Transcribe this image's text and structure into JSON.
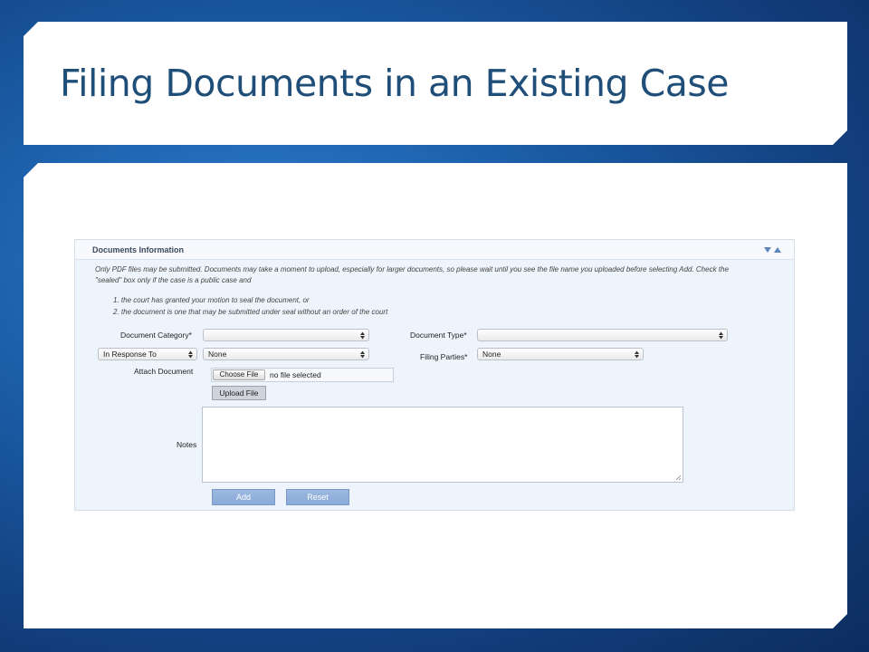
{
  "slide": {
    "title": "Filing Documents in an Existing Case"
  },
  "section": {
    "title": "Documents Information",
    "collapse_icon": "collapse-expand-arrows-icon"
  },
  "instructions": {
    "line1": "Only PDF files may be submitted. Documents may take a moment to upload, especially for larger documents, so please wait until you see the file name you uploaded before selecting Add. Check the",
    "line2": "\"sealed\" box only if the case is a public case and",
    "item1": "1.  the court has granted your motion to seal the document, or",
    "item2": "2.  the document is one that may be submitted under seal without an order of the court"
  },
  "form": {
    "document_category_label": "Document Category*",
    "document_category_value": "",
    "document_type_label": "Document Type*",
    "document_type_value": "",
    "relation_select_value": "In Response To",
    "relation_target_value": "None",
    "filing_parties_label": "Filing Parties*",
    "filing_parties_value": "None",
    "attach_label": "Attach Document",
    "choose_file_label": "Choose File",
    "file_status": "no file selected",
    "upload_label": "Upload File",
    "notes_label": "Notes",
    "notes_value": "",
    "add_label": "Add",
    "reset_label": "Reset"
  },
  "colors": {
    "title": "#1f4e79",
    "form_background": "#eef4fb",
    "action_button": "#8aaad8"
  }
}
